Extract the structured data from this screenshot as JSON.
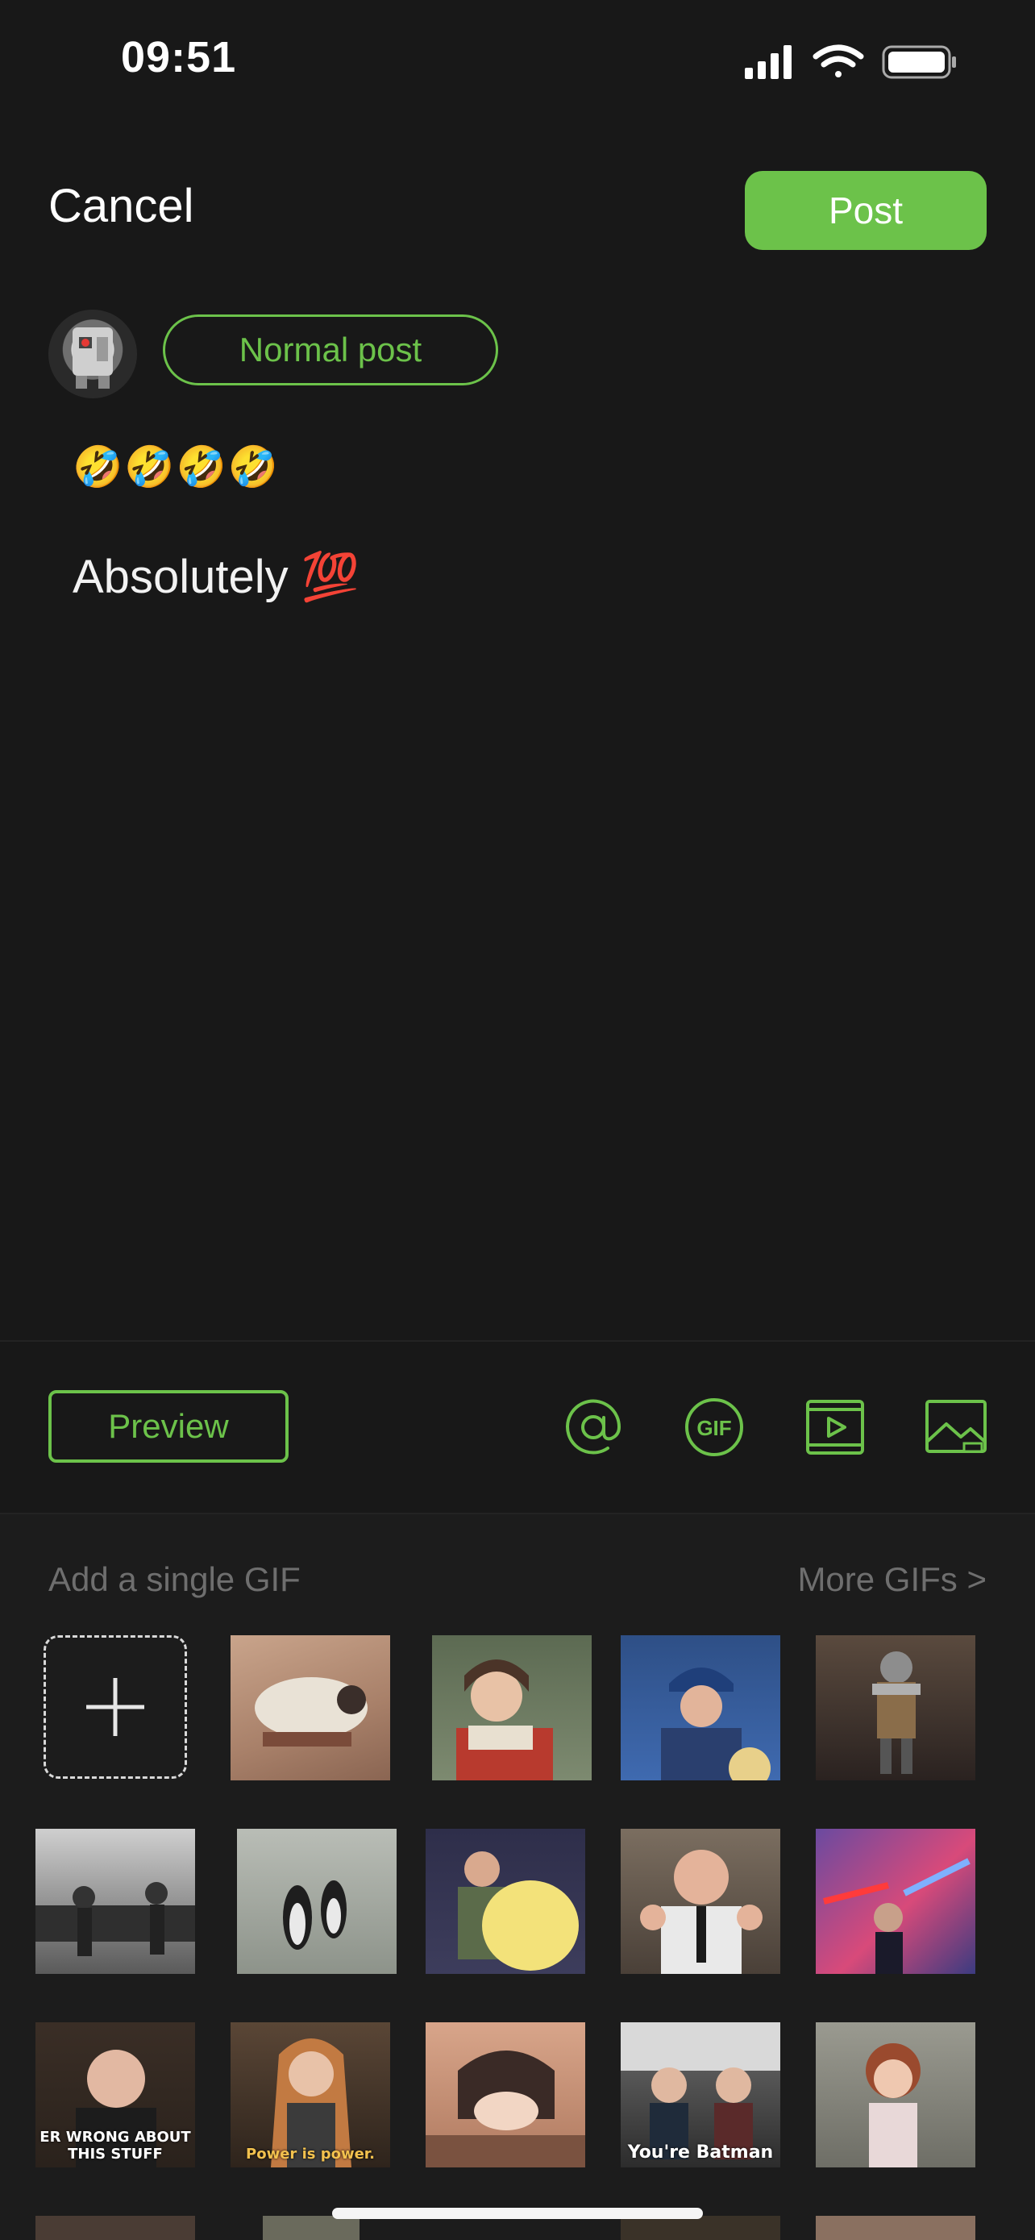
{
  "status_bar": {
    "time": "09:51"
  },
  "header": {
    "cancel_label": "Cancel",
    "post_label": "Post"
  },
  "composer": {
    "post_type": "Normal post",
    "emoji_line": "🤣🤣🤣🤣",
    "body_text": "Absolutely 💯"
  },
  "toolbar": {
    "preview_label": "Preview",
    "icons": [
      "mention-icon",
      "gif-icon",
      "video-icon",
      "image-icon"
    ]
  },
  "gif_panel": {
    "hint": "Add a single GIF",
    "more_label": "More GIFs >",
    "gif_captions": {
      "wrong": "ER WRONG ABOUT THIS STUFF",
      "power": "Power is power.",
      "batman": "You're Batman"
    }
  },
  "colors": {
    "accent": "#6cc24a",
    "background": "#181818",
    "panel": "#1c1c1c",
    "muted": "#6e6e6e"
  }
}
